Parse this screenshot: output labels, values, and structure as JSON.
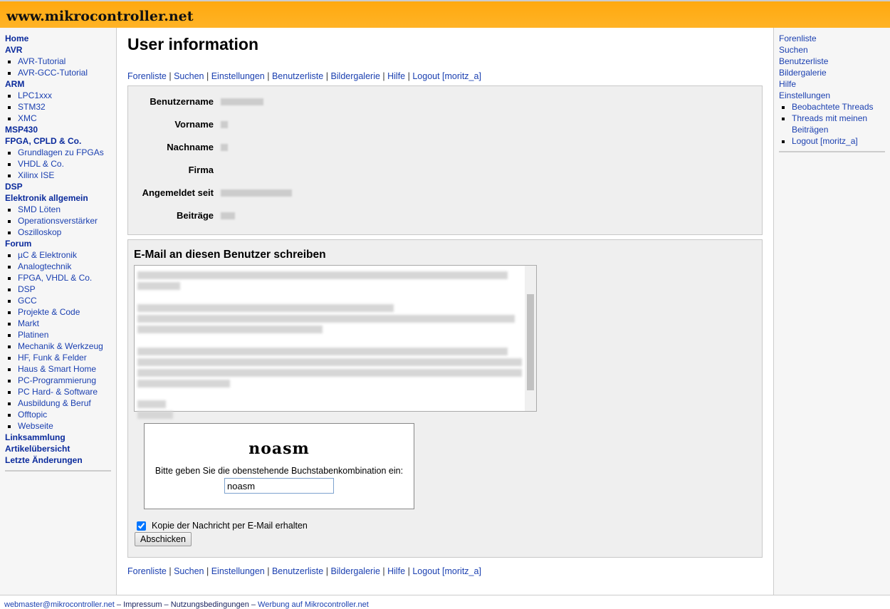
{
  "site_title": "www.mikrocontroller.net",
  "left_nav": [
    {
      "label": "Home",
      "bold": true
    },
    {
      "label": "AVR",
      "bold": true,
      "children": [
        "AVR-Tutorial",
        "AVR-GCC-Tutorial"
      ]
    },
    {
      "label": "ARM",
      "bold": true,
      "children": [
        "LPC1xxx",
        "STM32",
        "XMC"
      ]
    },
    {
      "label": "MSP430",
      "bold": true
    },
    {
      "label": "FPGA, CPLD & Co.",
      "bold": true,
      "children": [
        "Grundlagen zu FPGAs",
        "VHDL & Co.",
        "Xilinx ISE"
      ]
    },
    {
      "label": "DSP",
      "bold": true
    },
    {
      "label": "Elektronik allgemein",
      "bold": true,
      "children": [
        "SMD Löten",
        "Operationsverstärker",
        "Oszilloskop"
      ]
    },
    {
      "label": "Forum",
      "bold": true,
      "children": [
        "µC & Elektronik",
        "Analogtechnik",
        "FPGA, VHDL & Co.",
        "DSP",
        "GCC",
        "Projekte & Code",
        "Markt",
        "Platinen",
        "Mechanik & Werkzeug",
        "HF, Funk & Felder",
        "Haus & Smart Home",
        "PC-Programmierung",
        "PC Hard- & Software",
        "Ausbildung & Beruf",
        "Offtopic",
        "Webseite"
      ]
    },
    {
      "label": "Linksammlung",
      "bold": true
    },
    {
      "label": "Artikelübersicht",
      "bold": true
    },
    {
      "label": "Letzte Änderungen",
      "bold": true
    }
  ],
  "right_nav": {
    "items": [
      "Forenliste",
      "Suchen",
      "Benutzerliste",
      "Bildergalerie",
      "Hilfe",
      "Einstellungen"
    ],
    "children": [
      "Beobachtete Threads",
      "Threads mit meinen Beiträgen",
      "Logout [moritz_a]"
    ]
  },
  "page_title": "User information",
  "links": [
    "Forenliste",
    "Suchen",
    "Einstellungen",
    "Benutzerliste",
    "Bildergalerie",
    "Hilfe",
    "Logout [moritz_a]"
  ],
  "info_labels": [
    "Benutzername",
    "Vorname",
    "Nachname",
    "Firma",
    "Angemeldet seit",
    "Beiträge"
  ],
  "mail": {
    "heading": "E-Mail an diesen Benutzer schreiben",
    "captcha_image_text": "noasm",
    "captcha_prompt": "Bitte geben Sie die obenstehende Buchstabenkombination ein:",
    "captcha_value": "noasm",
    "copy_label": "Kopie der Nachricht per E-Mail erhalten",
    "submit": "Abschicken"
  },
  "footer": {
    "email": "webmaster@mikrocontroller.net",
    "sep": " – ",
    "impressum": "Impressum",
    "terms": "Nutzungsbedingungen",
    "ads": "Werbung auf Mikrocontroller.net"
  }
}
